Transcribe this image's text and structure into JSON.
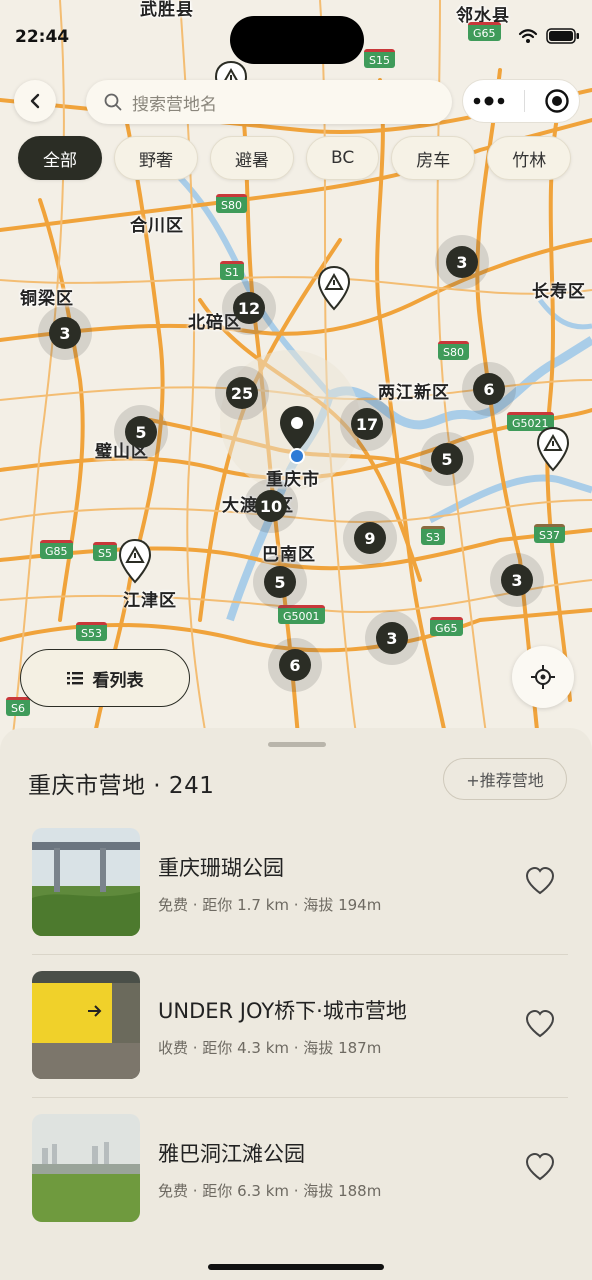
{
  "status_bar": {
    "time": "22:44"
  },
  "search": {
    "placeholder": "搜索营地名"
  },
  "chips": [
    "全部",
    "野奢",
    "避暑",
    "BC",
    "房车",
    "竹林"
  ],
  "map": {
    "places": [
      "武胜县",
      "邻水县",
      "合川区",
      "铜梁区",
      "北碚区",
      "长寿区",
      "两江新区",
      "璧山区",
      "重庆市",
      "大渡口区",
      "巴南区",
      "江津区"
    ],
    "highways": [
      "G65",
      "S15",
      "S80",
      "S1",
      "S80",
      "G5021",
      "G85",
      "S3",
      "S37",
      "S5",
      "G5001",
      "G65",
      "S53",
      "S6"
    ],
    "clusters": [
      "3",
      "3",
      "12",
      "25",
      "6",
      "5",
      "17",
      "5",
      "10",
      "9",
      "3",
      "5",
      "3",
      "6"
    ]
  },
  "list_button": {
    "label": "看列表"
  },
  "sheet": {
    "title": "重庆市营地 · 241",
    "recommend_label": "+推荐营地",
    "items": [
      {
        "name": "重庆珊瑚公园",
        "meta": "免费 · 距你 1.7 km · 海拔 194m"
      },
      {
        "name": "UNDER JOY桥下·城市营地",
        "meta": "收费 · 距你 4.3 km · 海拔 187m"
      },
      {
        "name": "雅巴洞江滩公园",
        "meta": "免费 · 距你 6.3 km · 海拔 188m"
      }
    ]
  },
  "colors": {
    "accent": "#2b2d25",
    "highway": "#3f9b5a",
    "road": "#f0a33b",
    "water": "#a9cde8",
    "sheet": "#ede9df"
  }
}
